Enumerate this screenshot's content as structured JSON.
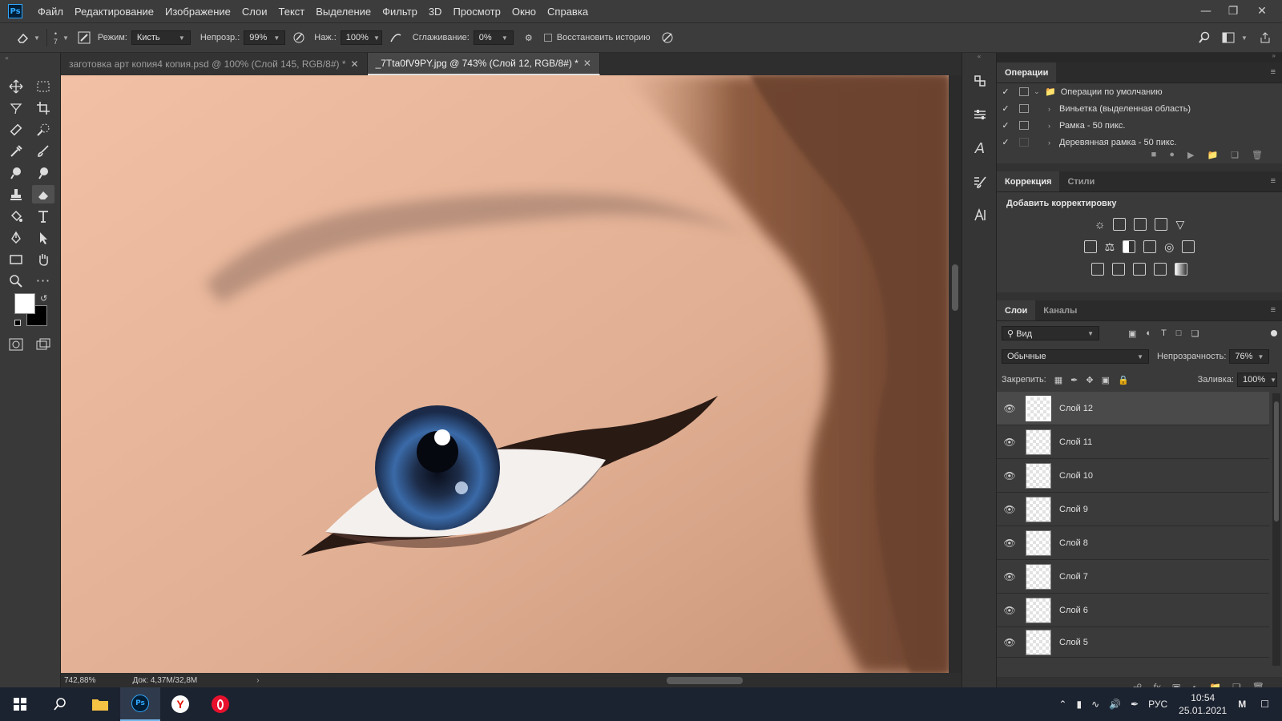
{
  "app": {
    "logo": "Ps"
  },
  "menu": [
    "Файл",
    "Редактирование",
    "Изображение",
    "Слои",
    "Текст",
    "Выделение",
    "Фильтр",
    "3D",
    "Просмотр",
    "Окно",
    "Справка"
  ],
  "options": {
    "brush_size": "7",
    "mode_label": "Режим:",
    "mode_value": "Кисть",
    "opacity_label": "Непрозр.:",
    "opacity_value": "99%",
    "pressure_label": "Наж.:",
    "pressure_value": "100%",
    "smoothing_label": "Сглаживание:",
    "smoothing_value": "0%",
    "restore_history": "Восстановить историю"
  },
  "tabs": [
    {
      "label": "заготовка арт копия4 копия.psd @ 100% (Слой 145, RGB/8#) *",
      "active": false
    },
    {
      "label": "_7Tta0fV9PY.jpg @ 743% (Слой 12, RGB/8#) *",
      "active": true
    }
  ],
  "status": {
    "zoom": "742,88%",
    "doc": "Док: 4,37M/32,8M"
  },
  "panels": {
    "actions": {
      "tab": "Операции",
      "set": "Операции по умолчанию",
      "items": [
        "Виньетка (выделенная область)",
        "Рамка - 50 пикс.",
        "Деревянная рамка - 50 пикс."
      ]
    },
    "adjustments": {
      "tabs": [
        "Коррекция",
        "Стили"
      ],
      "title": "Добавить корректировку"
    },
    "layers": {
      "tabs": [
        "Слои",
        "Каналы"
      ],
      "filter": "Вид",
      "blend": "Обычные",
      "opacity_label": "Непрозрачность:",
      "opacity_value": "76%",
      "lock_label": "Закрепить:",
      "fill_label": "Заливка:",
      "fill_value": "100%",
      "items": [
        "Слой 12",
        "Слой 11",
        "Слой 10",
        "Слой 9",
        "Слой 8",
        "Слой 7",
        "Слой 6",
        "Слой 5"
      ],
      "selected": "Слой 12"
    }
  },
  "taskbar": {
    "lang": "РУС",
    "time": "10:54",
    "date": "25.01.2021",
    "ps_label": "Ps"
  },
  "colors": {
    "accent": "#31a8ff",
    "panel": "#323232",
    "skin": "#d7a48c"
  }
}
